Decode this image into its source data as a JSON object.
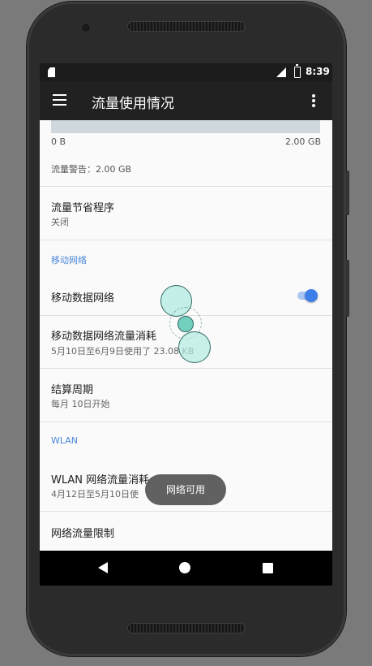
{
  "status": {
    "time": "8:39",
    "sim_icon": "sim-card-icon",
    "signal_icon": "lte-signal-icon",
    "battery_icon": "battery-charging-icon"
  },
  "appbar": {
    "title": "流量使用情况",
    "menu_icon": "hamburger-menu-icon",
    "more_icon": "more-vert-icon"
  },
  "usage_chart": {
    "min_label": "0 B",
    "max_label": "2.00 GB",
    "warning": "流量警告：2.00 GB",
    "bar_color": "#cfd8dc"
  },
  "data_saver": {
    "title": "流量节省程序",
    "subtitle": "关闭"
  },
  "mobile_section": {
    "header": "移动网络"
  },
  "mobile_data": {
    "title": "移动数据网络",
    "enabled": true
  },
  "mobile_usage": {
    "title": "移动数据网络流量消耗",
    "subtitle": "5月10日至6月9日使用了 23.08 KB"
  },
  "billing_cycle": {
    "title": "结算周期",
    "subtitle": "每月 10日开始"
  },
  "wlan_section": {
    "header": "WLAN"
  },
  "wlan_usage": {
    "title": "WLAN 网络流量消耗",
    "subtitle": "4月12日至5月10日使"
  },
  "network_limit": {
    "title": "网络流量限制"
  },
  "toast": {
    "text": "网络可用"
  },
  "colors": {
    "accent": "#3d7ee8",
    "section_header": "#4a86d8",
    "appbar": "#212121",
    "toast": "#616161"
  }
}
